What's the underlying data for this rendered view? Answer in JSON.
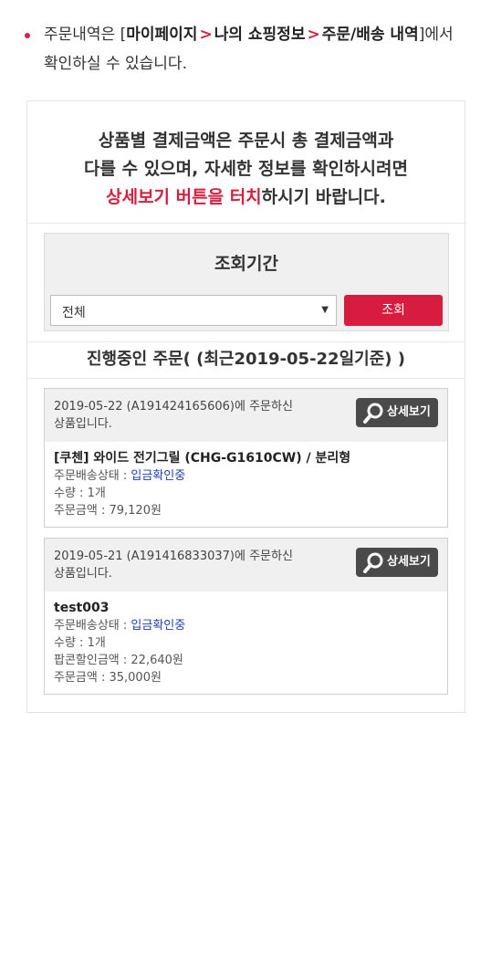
{
  "notice": {
    "prefix": "주문내역은 [",
    "path_1": "마이페이지",
    "path_2": "나의 쇼핑정보",
    "path_3": "주문/배송 내역",
    "suffix": "]에서 확인하실 수 있습니다.",
    "arrow": ">"
  },
  "intro": {
    "line1": "상품별 결제금액은 주문시 총 결제금액과",
    "line2": "다를 수 있으며, 자세한 정보를 확인하시려면",
    "line3_red": "상세보기 버튼을 터치",
    "line3_rest": "하시기 바랍니다."
  },
  "period": {
    "title": "조회기간",
    "select_value": "전체",
    "search_label": "조회"
  },
  "current": {
    "label": "진행중인 주문( (최근2019-05-22일기준) )"
  },
  "orders": [
    {
      "head_line1": "2019-05-22 (A191424165606)에 주문하신",
      "head_line2": "상품입니다.",
      "detail_label": "상세보기",
      "name": "[쿠첸] 와이드 전기그릴 (CHG-G1610CW) / 분리형",
      "status_label": "주문배송상태 : ",
      "status_value": "입금확인중",
      "qty": "수량 : 1개",
      "amount": "주문금액 : 79,120원"
    },
    {
      "head_line1": "2019-05-21 (A191416833037)에 주문하신",
      "head_line2": "상품입니다.",
      "detail_label": "상세보기",
      "name": "test003",
      "status_label": "주문배송상태 : ",
      "status_value": "입금확인중",
      "qty": "수량 : 1개",
      "discount": "팝콘할인금액 : 22,640원",
      "amount": "주문금액 : 35,000원"
    }
  ],
  "colors": {
    "accent": "#d81c3f",
    "status": "#1f3fa8",
    "detail_button": "#4a4a4a"
  }
}
